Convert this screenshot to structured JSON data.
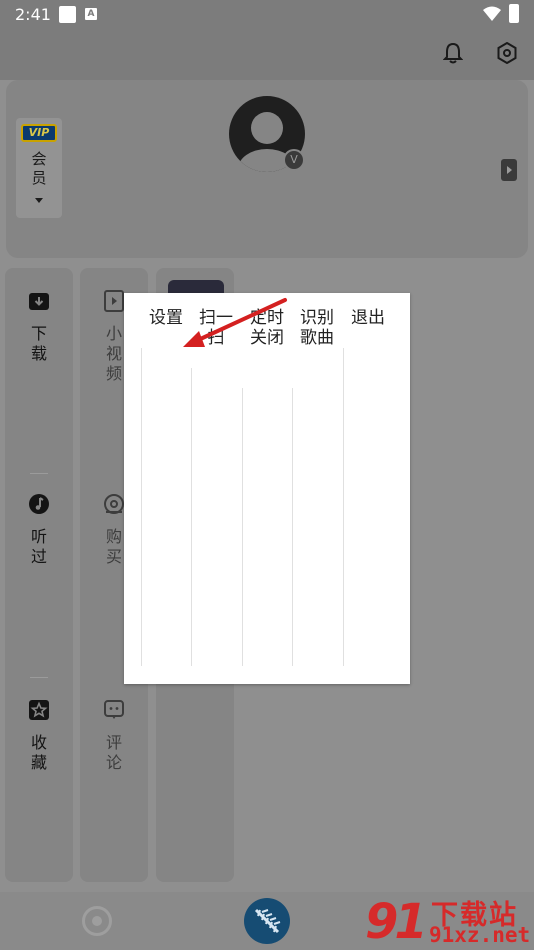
{
  "status_bar": {
    "time": "2:41",
    "a_icon_letter": "A"
  },
  "profile": {
    "vip_badge": "VIP",
    "vip_label": "会员",
    "avatar_badge": "V"
  },
  "grid": {
    "col1": [
      "下载",
      "听过",
      "收藏"
    ],
    "col2": [
      "小视频",
      "购买",
      "评论"
    ]
  },
  "popup_menu": {
    "items": [
      {
        "label": "设置"
      },
      {
        "label": "扫一扫"
      },
      {
        "label": "定时关闭"
      },
      {
        "label": "识别歌曲"
      },
      {
        "label": "退出"
      }
    ]
  },
  "annotation": {
    "color": "#d42020"
  },
  "watermark": {
    "logo": "91",
    "title": "下载站",
    "url": "91xz.net"
  }
}
